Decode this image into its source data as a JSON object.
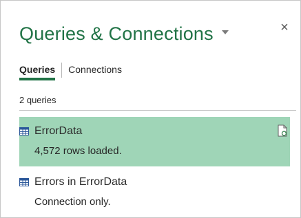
{
  "pane": {
    "title": "Queries & Connections",
    "icons": {
      "dropdown": "caret-down-icon",
      "close": "close-icon",
      "close_glyph": "×"
    },
    "accent_color": "#217346",
    "selected_color": "#9fd5b7"
  },
  "tabs": [
    {
      "label": "Queries",
      "active": true
    },
    {
      "label": "Connections",
      "active": false
    }
  ],
  "query_count_label": "2 queries",
  "queries": [
    {
      "name": "ErrorData",
      "status": "4,572 rows loaded.",
      "selected": true,
      "icon": "table-icon",
      "action_icon": "refresh-document-icon"
    },
    {
      "name": "Errors in ErrorData",
      "status": "Connection only.",
      "selected": false,
      "icon": "table-icon"
    }
  ]
}
